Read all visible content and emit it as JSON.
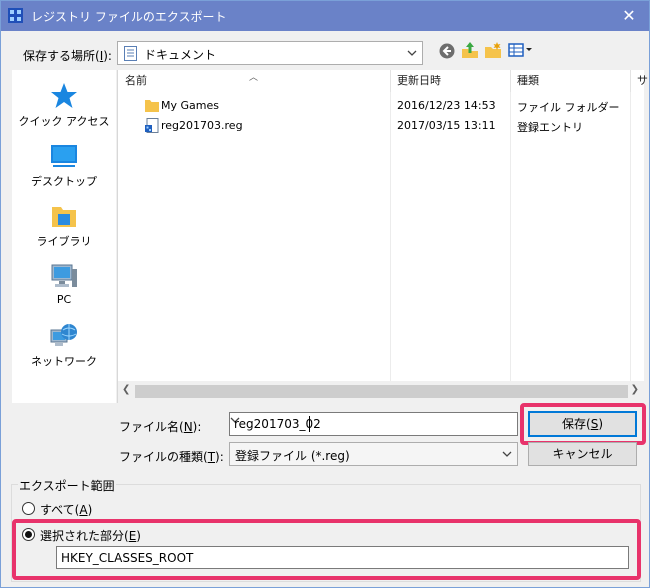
{
  "window": {
    "title": "レジストリ ファイルのエクスポート",
    "close_glyph": "✕"
  },
  "location": {
    "label_text": "保存する場所(",
    "label_key": "I",
    "label_suffix": "):",
    "value": "ドキュメント"
  },
  "toolbar": {
    "back_icon": "back-circle-icon",
    "up_icon": "up-folder-icon",
    "new_folder_icon": "new-folder-icon",
    "views_icon": "view-menu-icon"
  },
  "places": [
    {
      "label": "クイック アクセス",
      "icon": "star-icon"
    },
    {
      "label": "デスクトップ",
      "icon": "desktop-icon"
    },
    {
      "label": "ライブラリ",
      "icon": "library-icon"
    },
    {
      "label": "PC",
      "icon": "computer-icon"
    },
    {
      "label": "ネットワーク",
      "icon": "network-icon"
    }
  ],
  "list": {
    "columns": [
      "名前",
      "更新日時",
      "種類",
      "サ"
    ],
    "rows": [
      {
        "name": "My Games",
        "date": "2016/12/23 14:53",
        "type": "ファイル フォルダー",
        "icon": "folder-icon"
      },
      {
        "name": "reg201703.reg",
        "date": "2017/03/15 13:11",
        "type": "登録エントリ",
        "icon": "reg-file-icon"
      }
    ]
  },
  "filename": {
    "label_text": "ファイル名(",
    "label_key": "N",
    "label_suffix": "):",
    "value": "reg201703_02"
  },
  "filetype": {
    "label_text": "ファイルの種類(",
    "label_key": "T",
    "label_suffix": "):",
    "value": "登録ファイル (*.reg)"
  },
  "buttons": {
    "save_text": "保存(",
    "save_key": "S",
    "save_suffix": ")",
    "cancel": "キャンセル"
  },
  "export_range": {
    "legend": "エクスポート範囲",
    "all_text": "すべて(",
    "all_key": "A",
    "all_suffix": ")",
    "selected_text": "選択された部分(",
    "selected_key": "E",
    "selected_suffix": ")",
    "selected_value": "HKEY_CLASSES_ROOT",
    "selected_option": "selected"
  },
  "colors": {
    "titlebar": "#6a82c8",
    "highlight": "#e8336b",
    "accent": "#0078d7"
  }
}
